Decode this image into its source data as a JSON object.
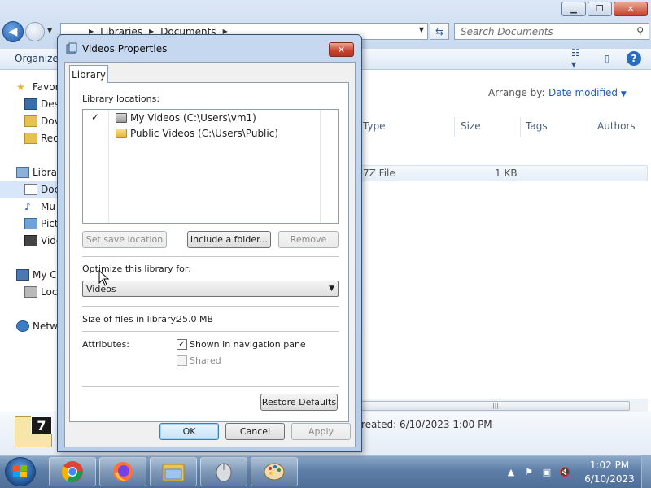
{
  "explorer": {
    "breadcrumb": [
      "Libraries",
      "Documents"
    ],
    "search_placeholder": "Search Documents",
    "toolbar": {
      "organize": "Organize"
    },
    "nav_items": [
      {
        "label": "Favor",
        "icon": "star-icon"
      },
      {
        "label": "Des",
        "icon": "desktop-icon"
      },
      {
        "label": "Dov",
        "icon": "downloads-icon"
      },
      {
        "label": "Rec",
        "icon": "recent-places-icon"
      },
      {
        "label": "Librar",
        "icon": "libraries-icon"
      },
      {
        "label": "Doc",
        "icon": "documents-icon"
      },
      {
        "label": "Mu",
        "icon": "music-icon"
      },
      {
        "label": "Pict",
        "icon": "pictures-icon"
      },
      {
        "label": "Vide",
        "icon": "videos-icon"
      },
      {
        "label": "My C",
        "icon": "computer-icon"
      },
      {
        "label": "Loc",
        "icon": "local-disk-icon"
      },
      {
        "label": "Netw",
        "icon": "network-icon"
      }
    ],
    "arrange_by_label": "Arrange by:",
    "arrange_by_value": "Date modified",
    "columns": [
      "Type",
      "Size",
      "Tags",
      "Authors"
    ],
    "file_row": {
      "type": "7Z File",
      "size": "1 KB"
    },
    "details": {
      "created": "reated: 6/10/2023 1:00 PM",
      "badge": "7"
    }
  },
  "dialog": {
    "title": "Videos Properties",
    "tab": "Library",
    "locations_label": "Library locations:",
    "locations": [
      {
        "label": "My Videos (C:\\Users\\vm1)",
        "checked": "✓"
      },
      {
        "label": "Public Videos (C:\\Users\\Public)",
        "checked": ""
      }
    ],
    "buttons": {
      "set_save": "Set save location",
      "include": "Include a folder...",
      "remove": "Remove",
      "restore": "Restore Defaults",
      "ok": "OK",
      "cancel": "Cancel",
      "apply": "Apply"
    },
    "optimize_label": "Optimize this library for:",
    "optimize_value": "Videos",
    "size_label": "Size of files in library:",
    "size_value": "25.0 MB",
    "attributes_label": "Attributes:",
    "attr_shown": "Shown in navigation pane",
    "attr_shared": "Shared"
  },
  "taskbar": {
    "clock_time": "1:02 PM",
    "clock_date": "6/10/2023"
  }
}
